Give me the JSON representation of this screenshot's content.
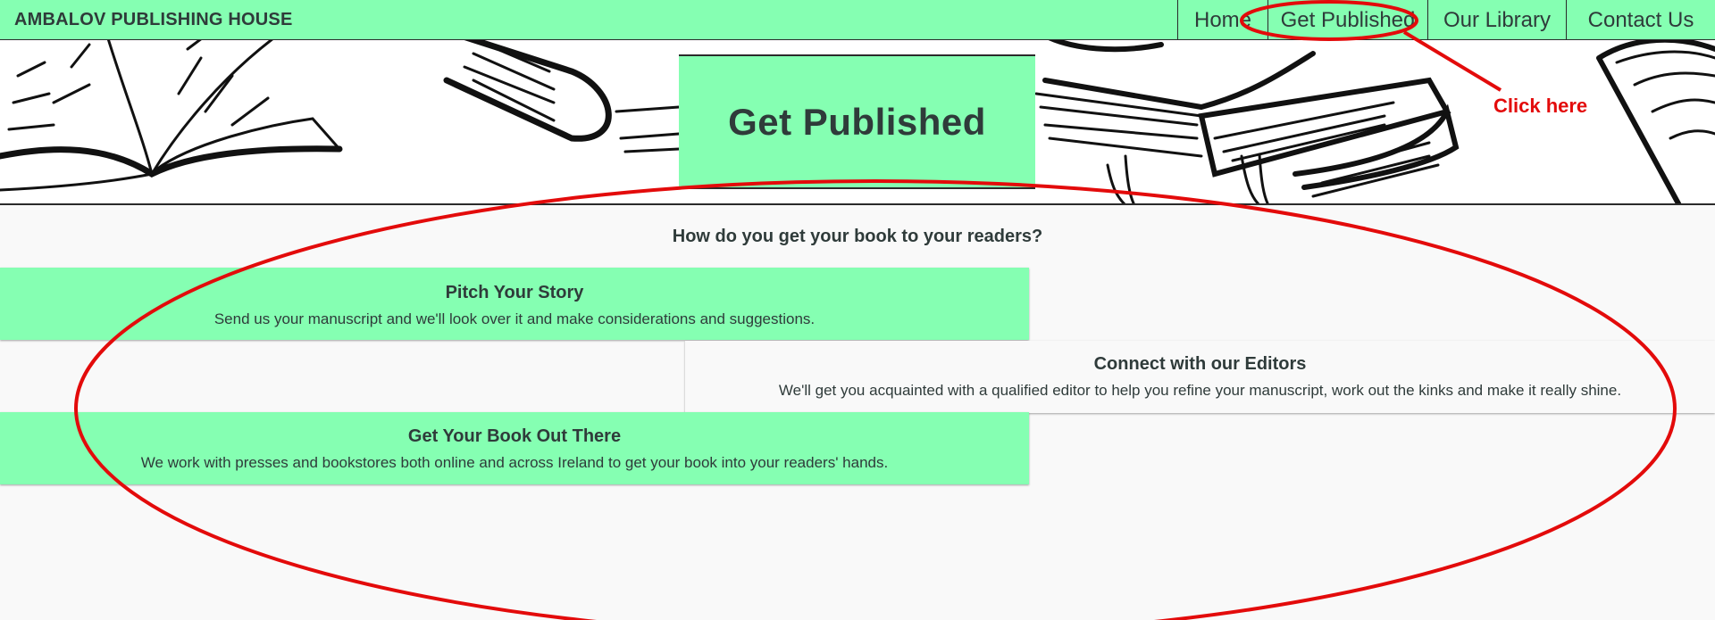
{
  "brand": "AMBALOV PUBLISHING HOUSE",
  "nav": {
    "home": "Home",
    "get_published": "Get Published",
    "our_library": "Our Library",
    "contact_us": "Contact Us"
  },
  "hero": {
    "title": "Get Published"
  },
  "main": {
    "question": "How do you get your book to your readers?",
    "cards": [
      {
        "title": "Pitch Your Story",
        "text": "Send us your manuscript and we'll look over it and make considerations and suggestions."
      },
      {
        "title": "Connect with our Editors",
        "text": "We'll get you acquainted with a qualified editor to help you refine your manuscript, work out the kinks and make it really shine."
      },
      {
        "title": "Get Your Book Out There",
        "text": "We work with presses and bookstores both online and across Ireland to get your book into your readers' hands."
      }
    ]
  },
  "annotation": {
    "label": "Click here",
    "color": "#e30b0b"
  },
  "colors": {
    "accent_green": "#85ffb2",
    "text": "#2f3b3a",
    "annotation_red": "#e30b0b"
  }
}
